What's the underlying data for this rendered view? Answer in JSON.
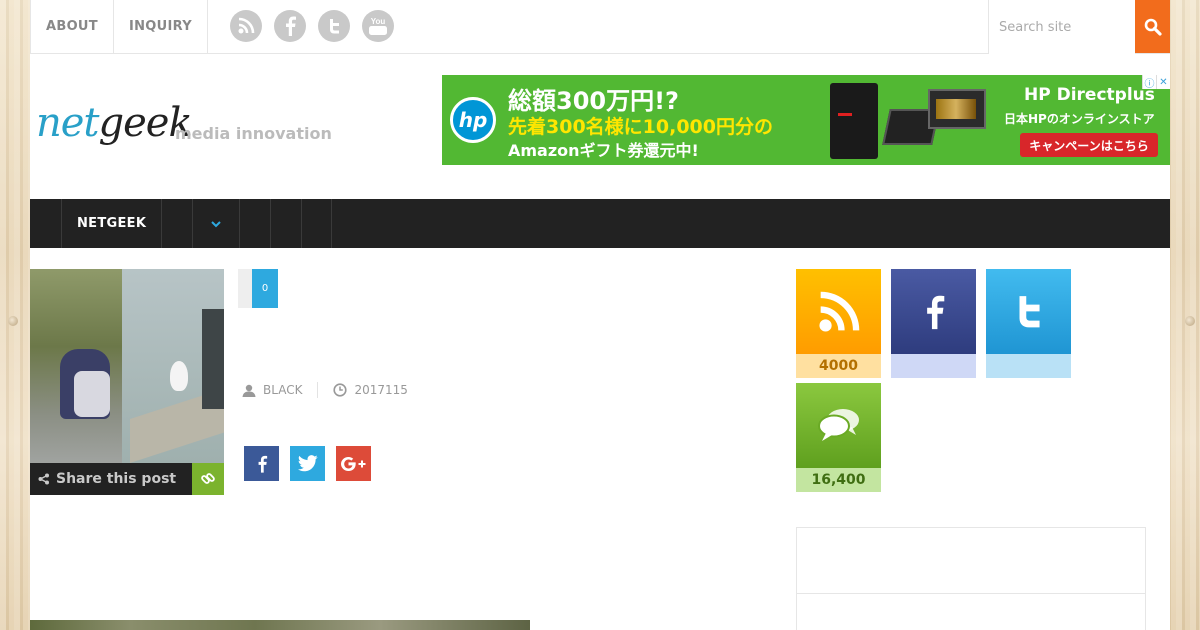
{
  "topbar": {
    "nav": [
      "ABOUT",
      "INQUIRY"
    ],
    "social_icons": [
      "rss-icon",
      "facebook-icon",
      "twitter-icon",
      "youtube-icon"
    ],
    "youtube_label": "You",
    "search_placeholder": "Search site",
    "accent_color": "#f26c1c"
  },
  "header": {
    "logo_net": "net",
    "logo_geek": "geek",
    "tagline": "media innovation"
  },
  "ad": {
    "line1": "総額300万円!?",
    "line2": "先着300名様に10,000円分の",
    "line3": "Amazonギフト券還元中!",
    "brand": "HP Directplus",
    "sub": "日本HPのオンラインストア",
    "cta": "キャンペーンはこちら",
    "hp": "hp",
    "background_color": "#52b833"
  },
  "mainnav": {
    "items": [
      "NETGEEK"
    ],
    "background_color": "#222222"
  },
  "post": {
    "comment_count": "0",
    "share_label": "Share this post",
    "author": "BLACK",
    "date": "2017115"
  },
  "sidebar": {
    "counters": [
      {
        "name": "rss",
        "count": "4000",
        "tile_color": "#ffa800",
        "count_bg": "#ffe0a0",
        "count_color": "#b37000"
      },
      {
        "name": "facebook",
        "count": "",
        "tile_color": "#3b4b8f",
        "count_bg": "#cfd8f6",
        "count_color": "#3b4b8f"
      },
      {
        "name": "twitter",
        "count": "",
        "tile_color": "#2ea9df",
        "count_bg": "#b9e1f6",
        "count_color": "#1f7fb0"
      },
      {
        "name": "comments",
        "count": "16,400",
        "tile_color": "#72b52d",
        "count_bg": "#c3e5a0",
        "count_color": "#3f6e12"
      }
    ]
  }
}
